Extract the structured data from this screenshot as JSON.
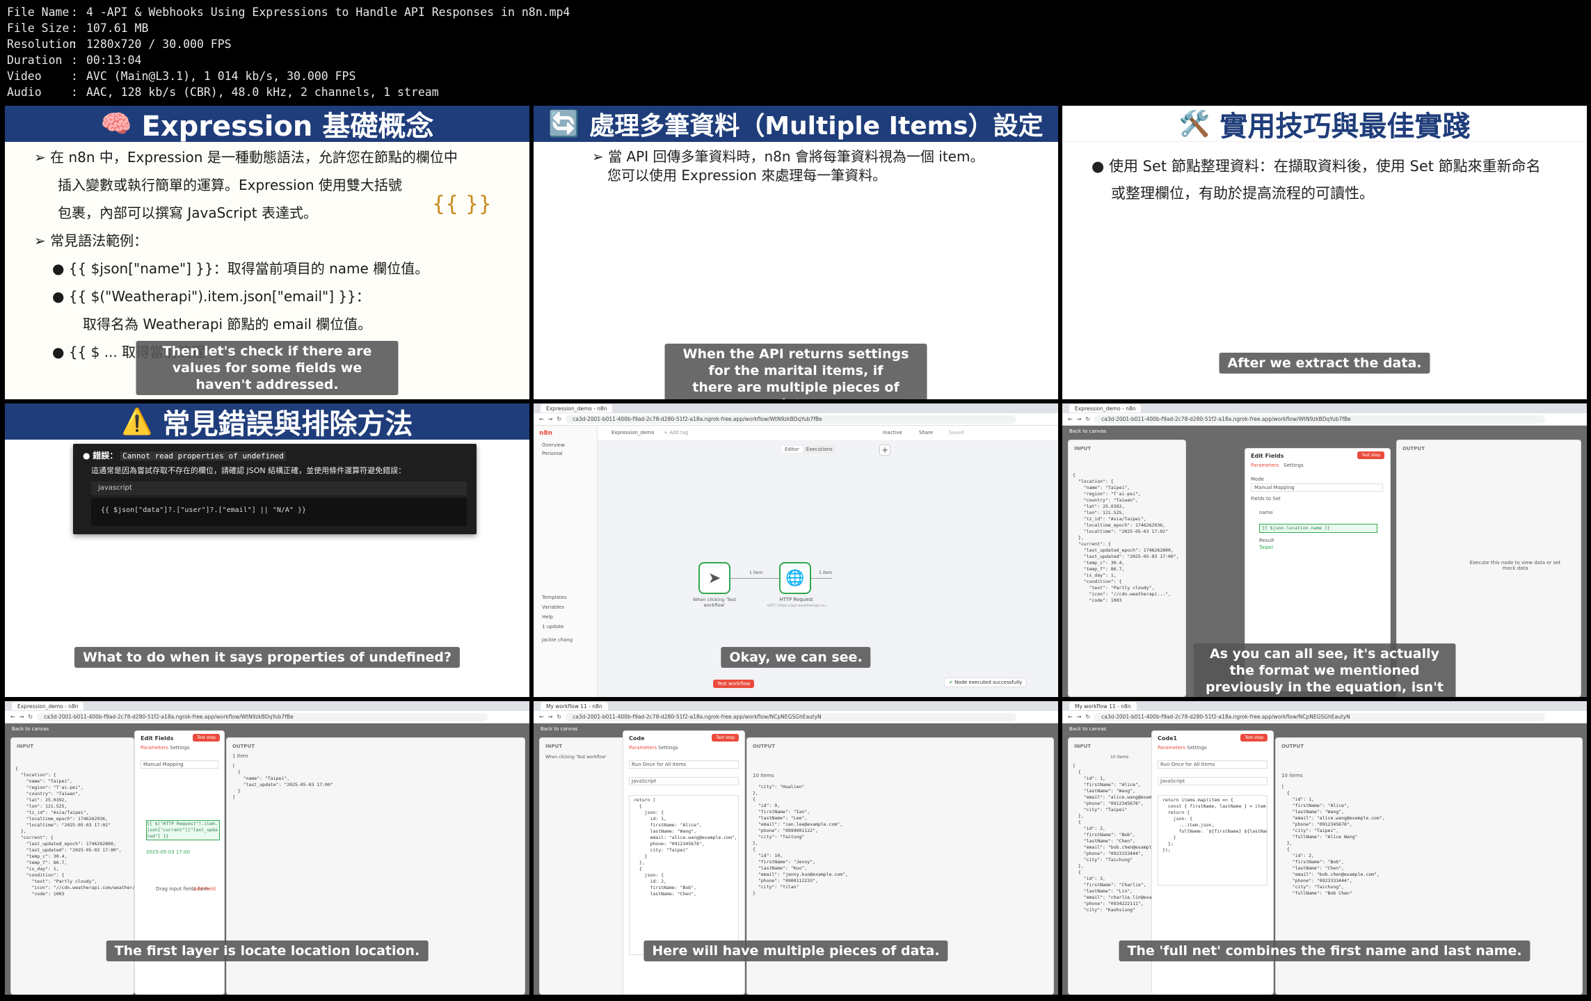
{
  "file_info": [
    {
      "key": "File Name",
      "value": "4 -API & Webhooks Using Expressions to Handle API Responses in n8n.mp4"
    },
    {
      "key": "File Size",
      "value": "107.61 MB"
    },
    {
      "key": "Resolution",
      "value": "1280x720 / 30.000 FPS"
    },
    {
      "key": "Duration",
      "value": "00:13:04"
    },
    {
      "key": "Video",
      "value": "AVC (Main@L3.1), 1 014 kb/s, 30.000 FPS"
    },
    {
      "key": "Audio",
      "value": "AAC, 128 kb/s (CBR), 48.0 kHz, 2 channels, 1 stream"
    }
  ],
  "tiles": {
    "t1": {
      "title": "Expression 基礎概念",
      "icon": "🧠",
      "lines": [
        "➢ 在 n8n 中，Expression 是一種動態語法，允許您在節點的欄位中",
        "插入變數或執行簡單的運算。Expression 使用雙大括號",
        "包裹，內部可以撰寫 JavaScript 表達式。",
        "➢ 常見語法範例：",
        "● {{ $json[\"name\"] }}：取得當前項目的 name 欄位值。",
        "● {{ $(\"Weatherapi\").item.json[\"email\"] }}：",
        "取得名為 Weatherapi 節點的 email 欄位值。",
        "● {{ $ ... 取得當前流程 ..."
      ],
      "braces": "{{    }}",
      "caption": "Then let's check if there are values for some fields we\nhaven't addressed."
    },
    "t2": {
      "title": "處理多筆資料（Multiple Items）設定",
      "icon": "🔄",
      "lines": [
        "➢ 當 API 回傳多筆資料時，n8n 會將每筆資料視為一個 item。",
        "您可以使用 Expression 來處理每一筆資料。"
      ],
      "caption": "When the API returns settings for the marital items, if\nthere are multiple pieces of data."
    },
    "t3": {
      "title": "實用技巧與最佳實踐",
      "icon": "🛠️",
      "lines": [
        "● 使用 Set 節點整理資料：在擷取資料後，使用 Set 節點來重新命名",
        "或整理欄位，有助於提高流程的可讀性。"
      ],
      "caption": "After we extract the data."
    },
    "t4": {
      "title": "常見錯誤與排除方法",
      "icon": "⚠️",
      "error_label": "錯誤：",
      "error_code": "Cannot read properties of undefined",
      "error_desc": "這通常是因為嘗試存取不存在的欄位，請確認 JSON 結構正確，並使用條件運算符避免錯誤：",
      "lang": "javascript",
      "code": "{{ $json[\"data\"]?.[\"user\"]?.[\"email\"] || \"N/A\" }}",
      "caption": "What to do when it says properties of undefined?"
    },
    "t5": {
      "tab": "Expression_demo - n8n",
      "url": "ca3d-2001-b011-400b-f9ad-2c78-d280-51f2-a18a.ngrok-free.app/workflow/WtN9zkBDqYub7fBe",
      "workflow_name": "Expression_demo",
      "add_tag": "+ Add tag",
      "inactive": "Inactive",
      "share": "Share",
      "saved": "Saved",
      "editor_tab": "Editor",
      "executions_tab": "Executions",
      "sidebar": [
        "Overview",
        "Personal"
      ],
      "sidebar_bottom": [
        "Templates",
        "Variables",
        "Help",
        "1 update"
      ],
      "user": "Jackie chang",
      "trigger_label": "When clicking 'Test workflow'",
      "http_label": "HTTP Request",
      "http_sub": "GET: https://api.weatherapi.co...",
      "item1": "1 item",
      "item2": "1 item",
      "test_button": "Test workflow",
      "toast": "Node executed successfully",
      "caption": "Okay, we can see."
    },
    "t6": {
      "back": "Back to canvas",
      "node_title": "Edit Fields",
      "input_label": "INPUT",
      "output_label": "OUTPUT",
      "params_tab": "Parameters",
      "settings_tab": "Settings",
      "test_step": "Test step",
      "mode_label": "Mode",
      "mode_value": "Manual Mapping",
      "fields_label": "Fields to Set",
      "field_name": "name",
      "expr": "{{ $json.location.name }}",
      "result_label": "Result",
      "result_value": "Taipei",
      "output_hint": "Execute this node to view data or set mock data",
      "json": "{\n  \"location\": {\n    \"name\": \"Taipei\",\n    \"region\": \"T'ai-pei\",\n    \"country\": \"Taiwan\",\n    \"lat\": 25.0392,\n    \"lon\": 121.525,\n    \"tz_id\": \"Asia/Taipei\",\n    \"localtime_epoch\": 1746262936,\n    \"localtime\": \"2025-05-03 17:02\"\n  },\n  \"current\": {\n    \"last_updated_epoch\": 1746262800,\n    \"last_updated\": \"2025-05-03 17:00\",\n    \"temp_c\": 30.4,\n    \"temp_f\": 86.7,\n    \"is_day\": 1,\n    \"condition\": {\n      \"text\": \"Partly cloudy\",\n      \"icon\": \"//cdn.weatherapi...\",\n      \"code\": 1003",
      "caption": "As you can all see, it's actually the format we mentioned\npreviously in the equation, isn't it quite friendly?"
    },
    "t7": {
      "tab": "Expression_demo - n8n",
      "url": "ca3d-2001-b011-400b-f9ad-2c78-d280-51f2-a18a.ngrok-free.app/workflow/WtN9zkBDqYub7fBe",
      "back": "Back to canvas",
      "node_title": "Edit Fields",
      "input_label": "INPUT",
      "output_label": "OUTPUT",
      "params_tab": "Parameters",
      "settings_tab": "Settings",
      "test_step": "Test step",
      "mode_value": "Manual Mapping",
      "expr": "{{ $(\"HTTP Request\").item.json[\"current\"][\"last_updated\"] }}",
      "result_value": "2025-05-03 17:00",
      "drag_hint": "Drag input fields here",
      "add_field": "Add Field",
      "output_items": "1 item",
      "output_json": "[\n  {\n    \"name\": \"Taipei\",\n    \"last_update\": \"2025-05-03 17:00\"\n  }\n]",
      "json": "{\n  \"location\": {\n    \"name\": \"Taipei\",\n    \"region\": \"T'ai-pei\",\n    \"country\": \"Taiwan\",\n    \"lat\": 25.0392,\n    \"lon\": 121.525,\n    \"tz_id\": \"Asia/Taipei\",\n    \"localtime_epoch\": 1746262936,\n    \"localtime\": \"2025-05-03 17:02\"\n  },\n  \"current\": {\n    \"last_updated_epoch\": 1746262800,\n    \"last_updated\": \"2025-05-03 17:00\",\n    \"temp_c\": 30.4,\n    \"temp_f\": 86.7,\n    \"is_day\": 1,\n    \"condition\": {\n      \"text\": \"Partly cloudy\",\n      \"icon\": \"//cdn.weatherapi.com/weather/64x64/day/116.png\",\n      \"code\": 1003",
      "caption": "The first layer is locate location location."
    },
    "t8": {
      "tab": "My workflow 11 - n8n",
      "url": "ca3d-2001-b011-400b-f9ad-2c78-d280-51f2-a18a.ngrok-free.app/workflow/NCpNEGSGhEautyN",
      "back": "Back to canvas",
      "node_title": "Code",
      "input_label": "INPUT",
      "output_label": "OUTPUT",
      "params_tab": "Parameters",
      "settings_tab": "Settings",
      "test_step": "Test step",
      "mode_value": "Run Once for All Items",
      "language_value": "JavaScript",
      "input_node": "When clicking 'Test workflow'",
      "output_items": "10 items",
      "code": "return [\n  {\n    json: {\n      id: 1,\n      firstName: \"Alice\",\n      lastName: \"Wang\",\n      email: \"alice.wang@example.com\",\n      phone: \"0912345678\",\n      city: \"Taipei\"\n    }\n  },\n  {\n    json: {\n      id: 2,\n      firstName: \"Bob\",\n      lastName: \"Chen\",",
      "output_json": "  \"city\": \"Hualien\"\n},\n{\n  \"id\": 9,\n  \"firstName\": \"Ian\",\n  \"lastName\": \"Lee\",\n  \"email\": \"ian.lee@example.com\",\n  \"phone\": \"0999001122\",\n  \"city\": \"Taitung\"\n},\n{\n  \"id\": 10,\n  \"firstName\": \"Jenny\",\n  \"lastName\": \"Kuo\",\n  \"email\": \"jenny.kuo@example.com\",\n  \"phone\": \"0900112233\",\n  \"city\": \"Yilan\"\n}",
      "caption": "Here will have multiple pieces of data."
    },
    "t9": {
      "tab": "My workflow 11 - n8n",
      "url": "ca3d-2001-b011-400b-f9ad-2c78-d280-51f2-a18a.ngrok-free.app/workflow/NCpNEGSGhEautyN",
      "back": "Back to canvas",
      "node_title": "Code1",
      "input_label": "INPUT",
      "output_label": "OUTPUT",
      "params_tab": "Parameters",
      "settings_tab": "Settings",
      "test_step": "Test step",
      "mode_value": "Run Once for All Items",
      "language_value": "JavaScript",
      "input_items": "10 items",
      "output_items": "10 items",
      "code": "return items.map(item => {\n  const { firstName, lastName } = item.json;\n  return {\n    json: {\n      ...item.json,\n      fullName: `${firstName} ${lastName}`\n    }\n  };\n});",
      "input_json": "[\n  {\n    \"id\": 1,\n    \"firstName\": \"Alice\",\n    \"lastName\": \"Wang\",\n    \"email\": \"alice.wang@example.com\",\n    \"phone\": \"0912345678\",\n    \"city\": \"Taipei\"\n  },\n  {\n    \"id\": 2,\n    \"firstName\": \"Bob\",\n    \"lastName\": \"Chen\",\n    \"email\": \"bob.chen@example.com\",\n    \"phone\": \"0923333444\",\n    \"city\": \"Taichung\"\n  },\n  {\n    \"id\": 3,\n    \"firstName\": \"Charlie\",\n    \"lastName\": \"Lin\",\n    \"email\": \"charlie.lin@example.com\",\n    \"phone\": \"0934222111\",\n    \"city\": \"Kaohsiung\"",
      "output_json": "[\n  {\n    \"id\": 1,\n    \"firstName\": \"Alice\",\n    \"lastName\": \"Wang\",\n    \"email\": \"alice.wang@example.com\",\n    \"phone\": \"0912345678\",\n    \"city\": \"Taipei\",\n    \"fullName\": \"Alice Wang\"\n  },\n  {\n    \"id\": 2,\n    \"firstName\": \"Bob\",\n    \"lastName\": \"Chen\",\n    \"email\": \"bob.chen@example.com\",\n    \"phone\": \"0923333444\",\n    \"city\": \"Taichung\",\n    \"fullName\": \"Bob Chen\"",
      "caption": "The 'full net' combines the first name and last name."
    }
  },
  "colors": {
    "slide_band": "#1f3d7a",
    "n8n_accent": "#ea4b3c",
    "success": "#2fa84f"
  }
}
